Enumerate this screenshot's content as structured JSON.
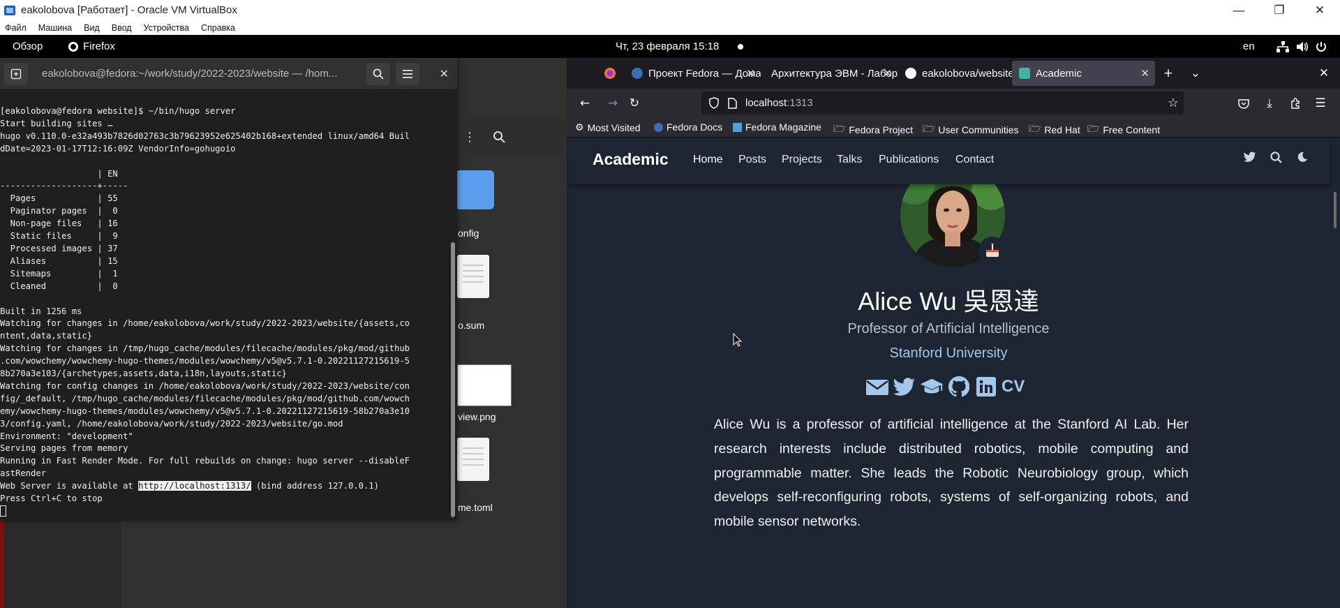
{
  "virtualbox": {
    "title": "eakolobova [Работает] - Oracle VM VirtualBox",
    "menu": [
      "Файл",
      "Машина",
      "Вид",
      "Ввод",
      "Устройства",
      "Справка"
    ]
  },
  "gnome": {
    "overview": "Обзор",
    "app": "Firefox",
    "clock": "Чт, 23 февраля  15:18",
    "lang": "en"
  },
  "filemanager": {
    "files": [
      "onfig",
      "o.sum",
      "view.png",
      "me.toml"
    ]
  },
  "terminal": {
    "title": "eakolobova@fedora:~/work/study/2022-2023/website — /hom...",
    "lines": [
      "[eakolobova@fedora website]$ ~/bin/hugo server",
      "Start building sites …",
      "hugo v0.110.0-e32a493b7826d02763c3b79623952e625402b168+extended linux/amd64 Buil",
      "dDate=2023-01-17T12:16:09Z VendorInfo=gohugoio",
      "",
      "                   | EN",
      "-------------------+-----",
      "  Pages            | 55",
      "  Paginator pages  |  0",
      "  Non-page files   | 16",
      "  Static files     |  9",
      "  Processed images | 37",
      "  Aliases          | 15",
      "  Sitemaps         |  1",
      "  Cleaned          |  0",
      "",
      "Built in 1256 ms",
      "Watching for changes in /home/eakolobova/work/study/2022-2023/website/{assets,co",
      "ntent,data,static}",
      "Watching for changes in /tmp/hugo_cache/modules/filecache/modules/pkg/mod/github",
      ".com/wowchemy/wowchemy-hugo-themes/modules/wowchemy/v5@v5.7.1-0.20221127215619-5",
      "8b270a3e103/{archetypes,assets,data,i18n,layouts,static}",
      "Watching for config changes in /home/eakolobova/work/study/2022-2023/website/con",
      "fig/_default, /tmp/hugo_cache/modules/filecache/modules/pkg/mod/github.com/wowch",
      "emy/wowchemy-hugo-themes/modules/wowchemy/v5@v5.7.1-0.20221127215619-58b270a3e10",
      "3/config.yaml, /home/eakolobova/work/study/2022-2023/website/go.mod",
      "Environment: \"development\"",
      "Serving pages from memory",
      "Running in Fast Render Mode. For full rebuilds on change: hugo server --disableF",
      "astRender"
    ],
    "server_prefix": "Web Server is available at ",
    "server_url": "http://localhost:1313/",
    "server_suffix": " (bind address 127.0.0.1)",
    "stop_line": "Press Ctrl+C to stop"
  },
  "firefox": {
    "tabs": [
      {
        "label": "Проект Fedora — Дома",
        "color": "#3c6eb4"
      },
      {
        "label": "Архитектура ЭВМ - Лабор",
        "color": "#e8a33d"
      },
      {
        "label": "eakolobova/website",
        "color": "#ffffff"
      },
      {
        "label": "Academic",
        "color": "#3eb5a4"
      }
    ],
    "url_host": "localhost",
    "url_port": ":1313",
    "bookmarks": [
      "Most Visited",
      "Fedora Docs",
      "Fedora Magazine",
      "Fedora Project",
      "User Communities",
      "Red Hat",
      "Free Content"
    ]
  },
  "site": {
    "brand": "Academic",
    "nav": [
      "Home",
      "Posts",
      "Projects",
      "Talks",
      "Publications",
      "Contact"
    ],
    "name": "Alice Wu 吳恩達",
    "role": "Professor of Artificial Intelligence",
    "organization": "Stanford University",
    "social_icons": [
      "envelope-icon",
      "twitter-icon",
      "graduation-cap-icon",
      "github-icon",
      "linkedin-icon",
      "cv-icon"
    ],
    "cv_label": "CV",
    "bio": "Alice Wu is a professor of artificial intelligence at the Stanford AI Lab. Her research interests include distributed robotics, mobile computing and programmable matter. She leads the Robotic Neurobiology group, which develops self-reconfiguring robots, systems of self-organizing robots, and mobile sensor networks."
  }
}
